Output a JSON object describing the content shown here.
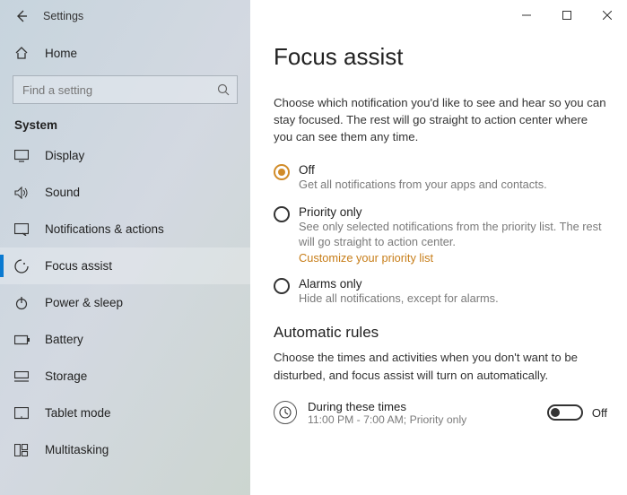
{
  "titlebar": {
    "app_title": "Settings"
  },
  "sidebar": {
    "home_label": "Home",
    "search_placeholder": "Find a setting",
    "section": "System",
    "items": [
      {
        "icon": "display",
        "label": "Display"
      },
      {
        "icon": "sound",
        "label": "Sound"
      },
      {
        "icon": "notifications",
        "label": "Notifications & actions"
      },
      {
        "icon": "focus",
        "label": "Focus assist"
      },
      {
        "icon": "power",
        "label": "Power & sleep"
      },
      {
        "icon": "battery",
        "label": "Battery"
      },
      {
        "icon": "storage",
        "label": "Storage"
      },
      {
        "icon": "tablet",
        "label": "Tablet mode"
      },
      {
        "icon": "multitask",
        "label": "Multitasking"
      }
    ],
    "selected_index": 3
  },
  "main": {
    "heading": "Focus assist",
    "description": "Choose which notification you'd like to see and hear so you can stay focused. The rest will go straight to action center where you can see them any time.",
    "options": [
      {
        "title": "Off",
        "sub": "Get all notifications from your apps and contacts.",
        "selected": true
      },
      {
        "title": "Priority only",
        "sub": "See only selected notifications from the priority list. The rest will go straight to action center.",
        "link": "Customize your priority list",
        "selected": false
      },
      {
        "title": "Alarms only",
        "sub": "Hide all notifications, except for alarms.",
        "selected": false
      }
    ],
    "rules_heading": "Automatic rules",
    "rules_desc": "Choose the times and activities when you don't want to be disturbed, and focus assist will turn on automatically.",
    "rule1": {
      "title": "During these times",
      "sub": "11:00 PM - 7:00 AM; Priority only",
      "state_label": "Off"
    }
  }
}
